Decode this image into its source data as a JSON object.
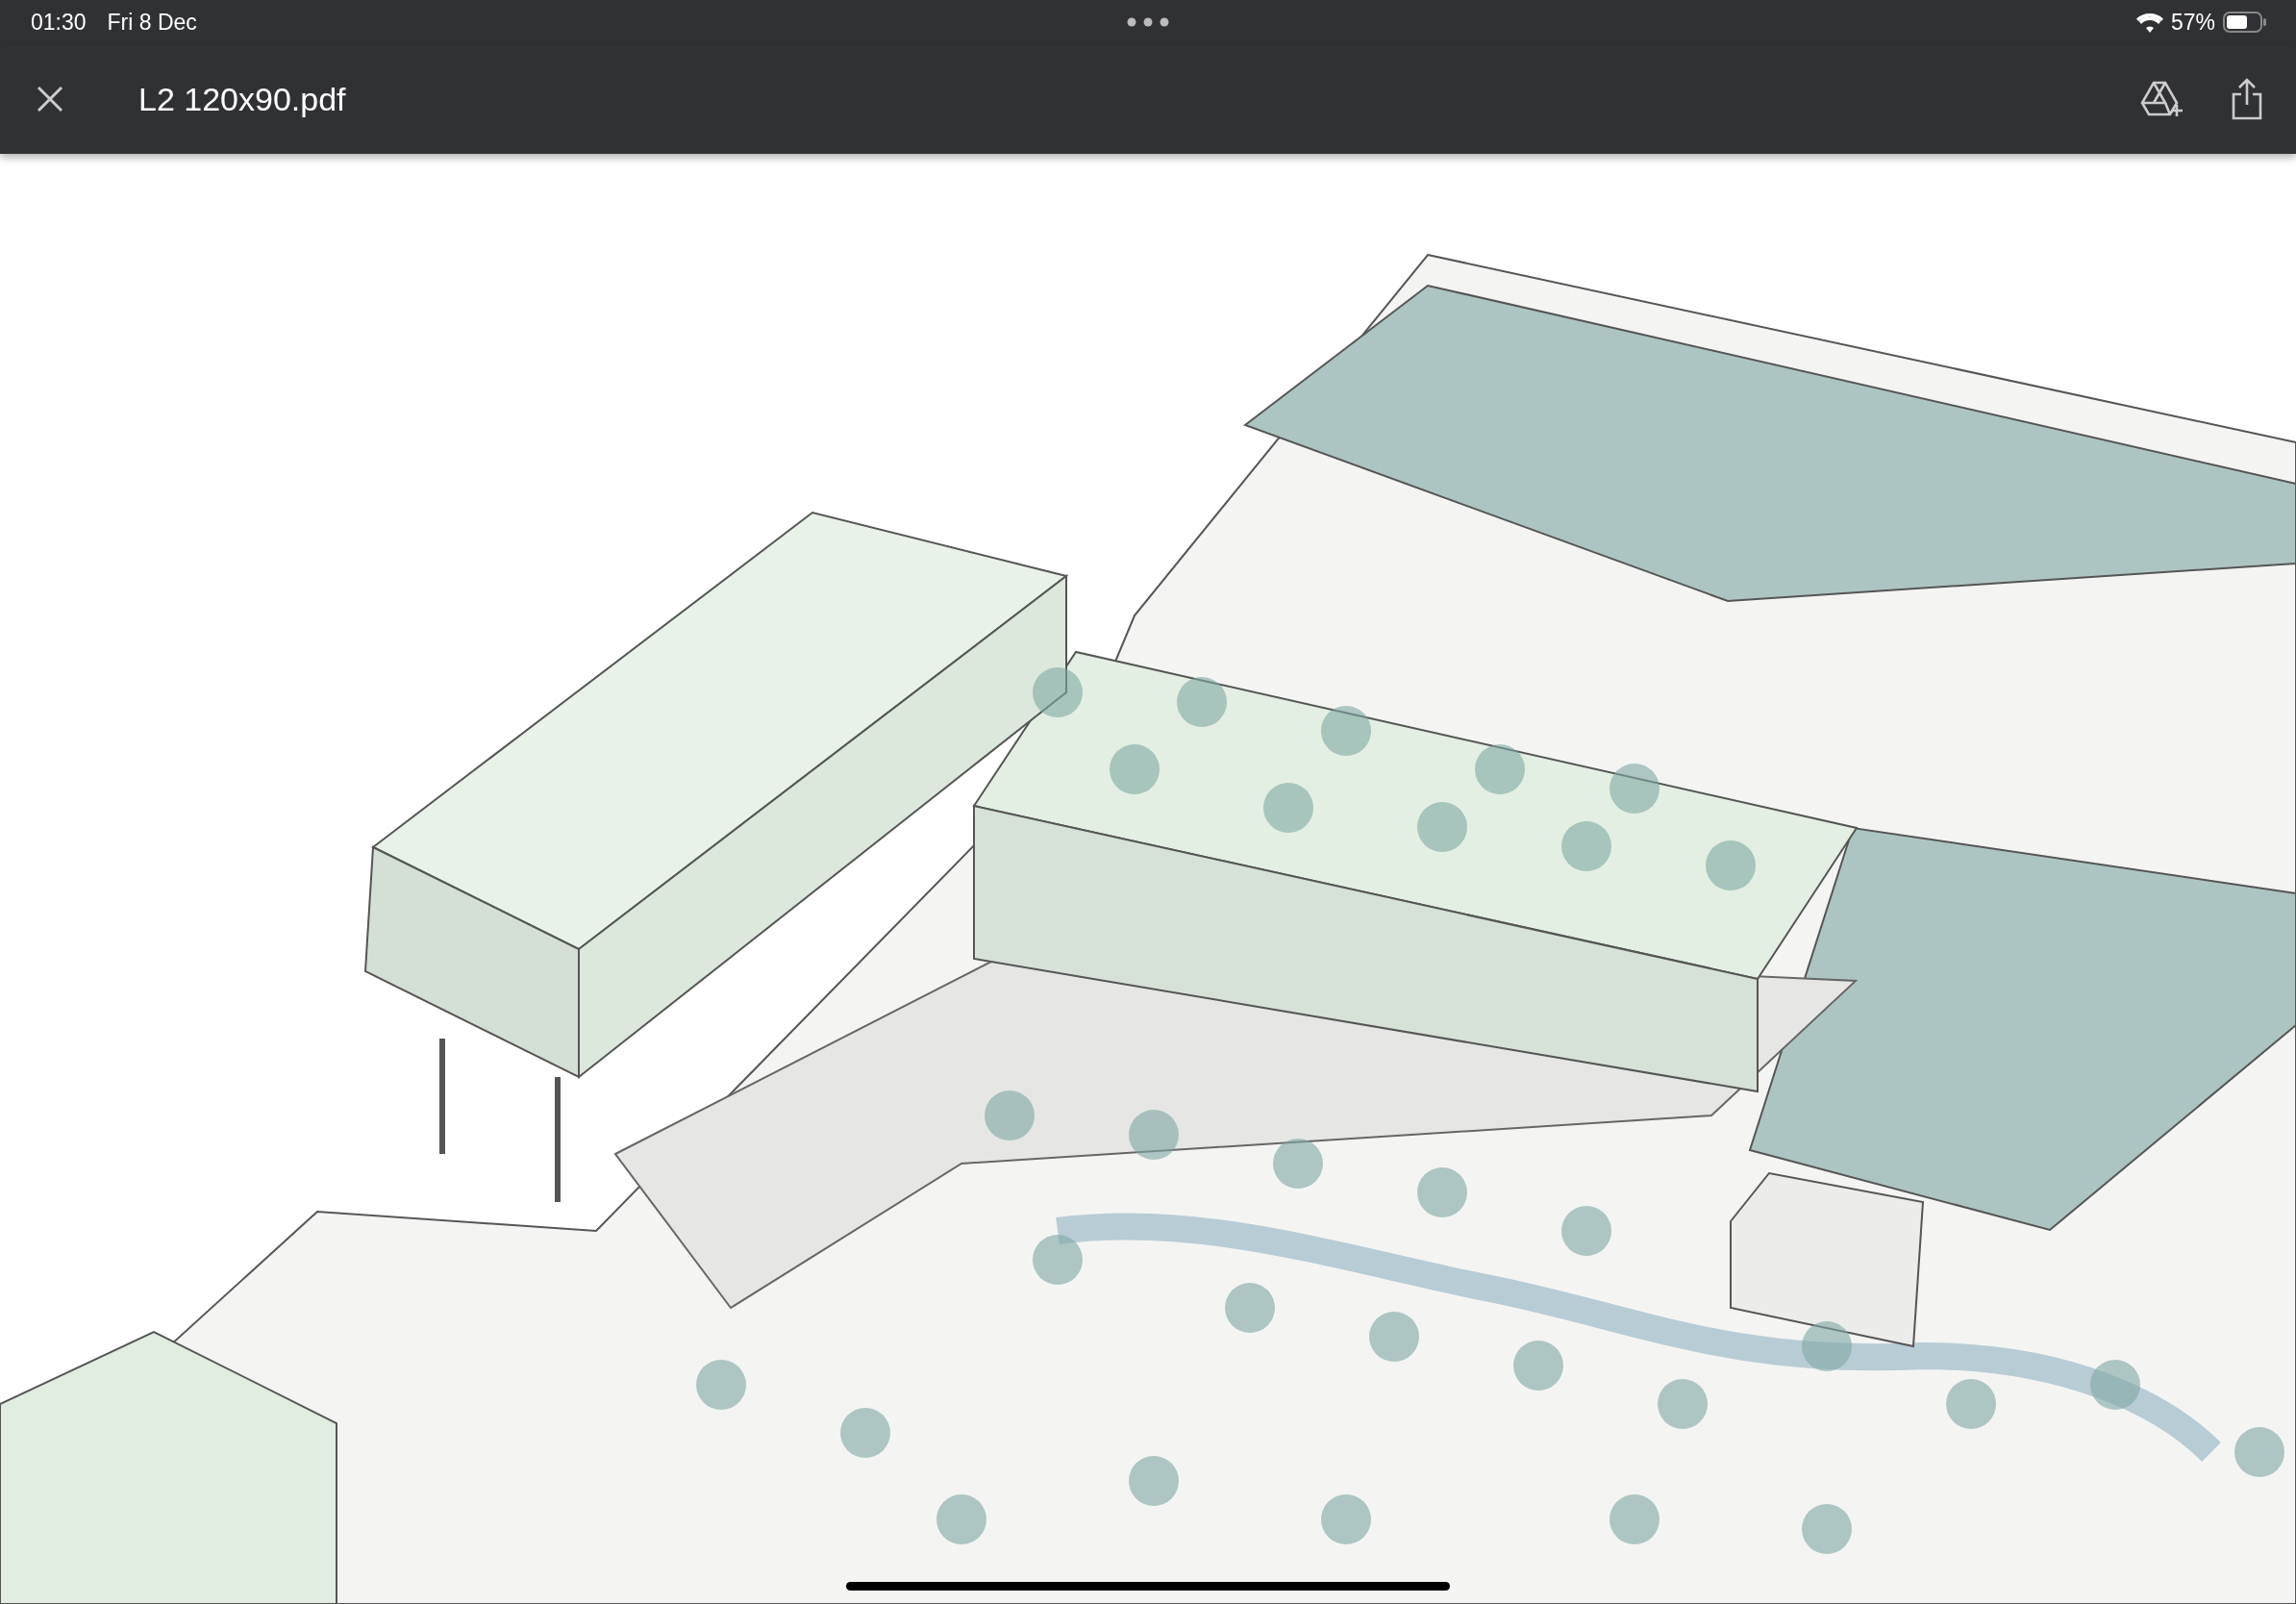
{
  "status_bar": {
    "time": "01:30",
    "date": "Fri 8 Dec",
    "battery": "57%"
  },
  "toolbar": {
    "title": "L2 120x90.pdf"
  }
}
